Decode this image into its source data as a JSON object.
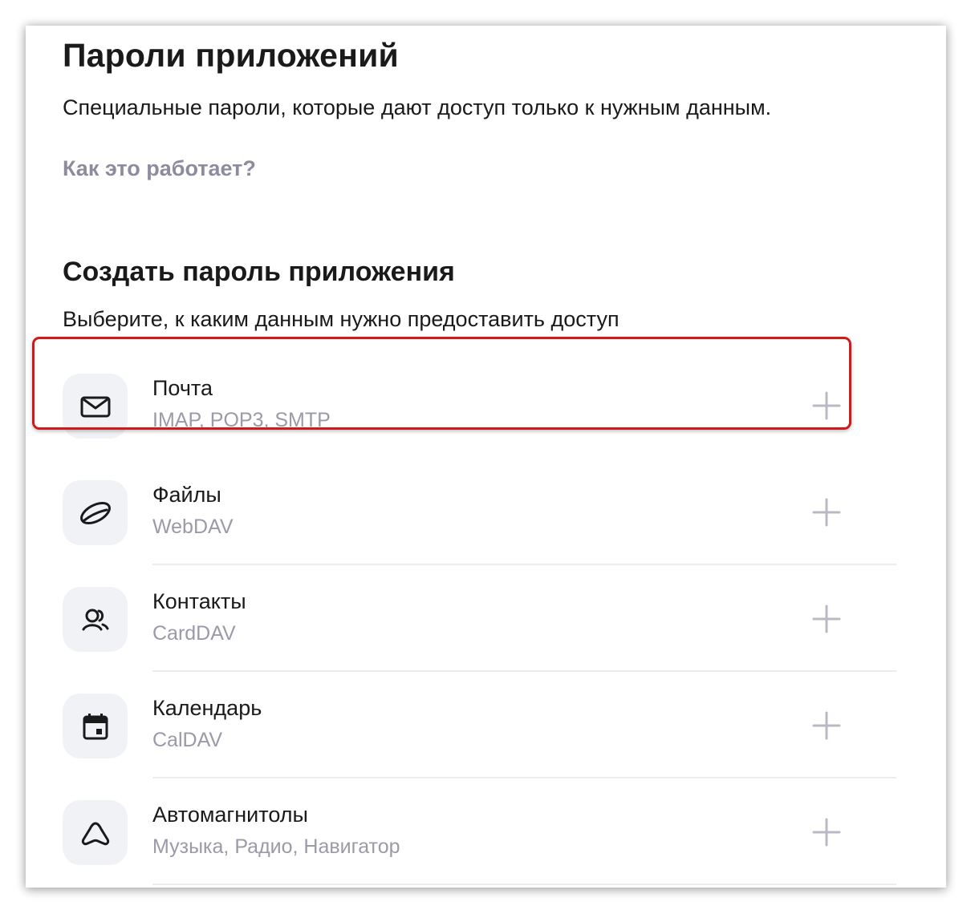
{
  "page": {
    "title": "Пароли приложений",
    "description": "Специальные пароли, которые дают доступ только к нужным данным.",
    "how_link": "Как это работает?"
  },
  "create": {
    "title": "Создать пароль приложения",
    "subtitle": "Выберите, к каким данным нужно предоставить доступ"
  },
  "apps": [
    {
      "title": "Почта",
      "subtitle": "IMAP, POP3, SMTP",
      "icon": "mail-icon",
      "highlighted": true
    },
    {
      "title": "Файлы",
      "subtitle": "WebDAV",
      "icon": "disk-icon"
    },
    {
      "title": "Контакты",
      "subtitle": "CardDAV",
      "icon": "contacts-icon"
    },
    {
      "title": "Календарь",
      "subtitle": "CalDAV",
      "icon": "calendar-icon"
    },
    {
      "title": "Автомагнитолы",
      "subtitle": "Музыка, Радио, Навигатор",
      "icon": "car-icon"
    }
  ],
  "colors": {
    "text": "#1a1a1a",
    "muted": "#9a9aa8",
    "link": "#8c8c9e",
    "icon_bg": "#f1f2f6",
    "plus": "#b9b9c6",
    "highlight": "#d01a1a"
  }
}
